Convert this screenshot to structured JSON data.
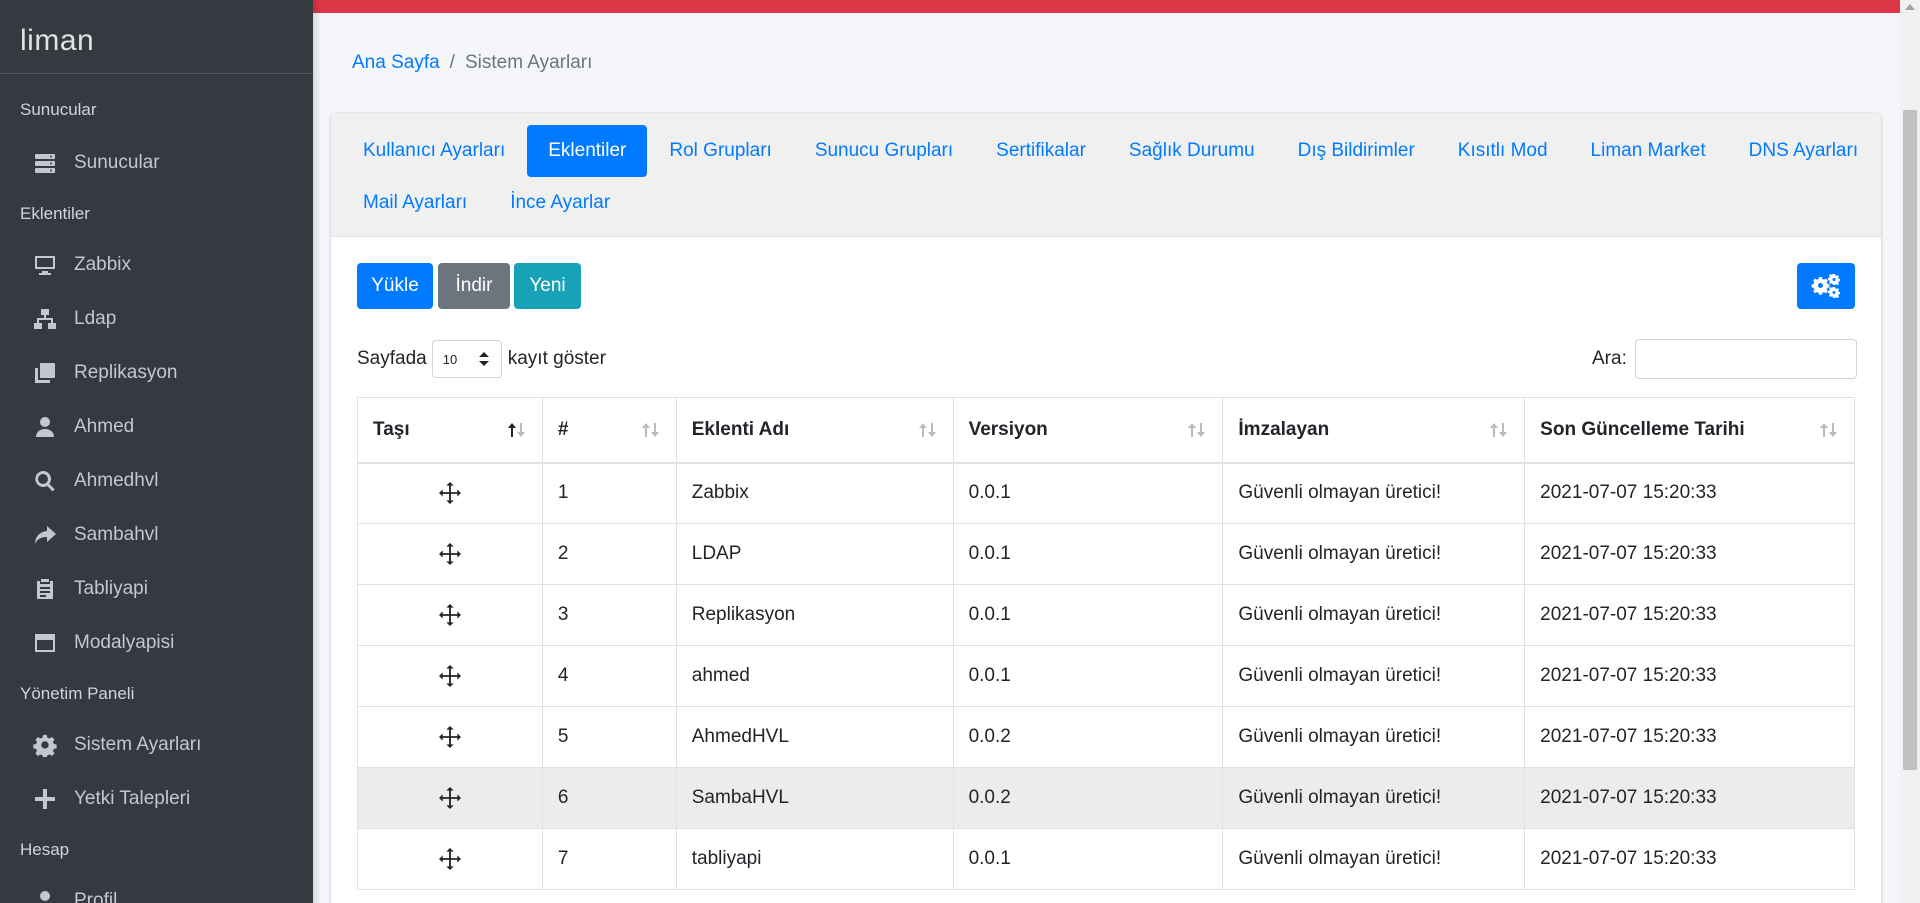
{
  "brand": "liman",
  "sidebar": {
    "sections": [
      {
        "header": "Sunucular",
        "items": [
          {
            "label": "Sunucular",
            "icon": "server-icon"
          }
        ]
      },
      {
        "header": "Eklentiler",
        "items": [
          {
            "label": "Zabbix",
            "icon": "desktop-icon"
          },
          {
            "label": "Ldap",
            "icon": "sitemap-icon"
          },
          {
            "label": "Replikasyon",
            "icon": "copy-icon"
          },
          {
            "label": "Ahmed",
            "icon": "user-icon"
          },
          {
            "label": "Ahmedhvl",
            "icon": "search-icon"
          },
          {
            "label": "Sambahvl",
            "icon": "share-icon"
          },
          {
            "label": "Tabliyapi",
            "icon": "clipboard-icon"
          },
          {
            "label": "Modalyapisi",
            "icon": "window-icon"
          }
        ]
      },
      {
        "header": "Yönetim Paneli",
        "items": [
          {
            "label": "Sistem Ayarları",
            "icon": "gear-icon"
          },
          {
            "label": "Yetki Talepleri",
            "icon": "plus-icon"
          }
        ]
      },
      {
        "header": "Hesap",
        "items": [
          {
            "label": "Profil",
            "icon": "user-icon"
          }
        ]
      }
    ]
  },
  "breadcrumb": {
    "home": "Ana Sayfa",
    "separator": "/",
    "current": "Sistem Ayarları"
  },
  "tabs": [
    {
      "label": "Kullanıcı Ayarları",
      "active": false
    },
    {
      "label": "Eklentiler",
      "active": true
    },
    {
      "label": "Rol Grupları",
      "active": false
    },
    {
      "label": "Sunucu Grupları",
      "active": false
    },
    {
      "label": "Sertifikalar",
      "active": false
    },
    {
      "label": "Sağlık Durumu",
      "active": false
    },
    {
      "label": "Dış Bildirimler",
      "active": false
    },
    {
      "label": "Kısıtlı Mod",
      "active": false
    },
    {
      "label": "Liman Market",
      "active": false
    },
    {
      "label": "DNS Ayarları",
      "active": false
    },
    {
      "label": "Mail Ayarları",
      "active": false
    },
    {
      "label": "İnce Ayarlar",
      "active": false
    }
  ],
  "toolbar": {
    "upload": "Yükle",
    "download": "İndir",
    "new": "Yeni",
    "settings_icon": "cogs-icon"
  },
  "length": {
    "prefix": "Sayfada",
    "value": "10",
    "suffix": "kayıt göster"
  },
  "search": {
    "label": "Ara:",
    "value": ""
  },
  "table": {
    "columns": [
      "Taşı",
      "#",
      "Eklenti Adı",
      "Versiyon",
      "İmzalayan",
      "Son Güncelleme Tarihi"
    ],
    "rows": [
      {
        "num": "1",
        "name": "Zabbix",
        "version": "0.0.1",
        "signer": "Güvenli olmayan üretici!",
        "updated": "2021-07-07 15:20:33"
      },
      {
        "num": "2",
        "name": "LDAP",
        "version": "0.0.1",
        "signer": "Güvenli olmayan üretici!",
        "updated": "2021-07-07 15:20:33"
      },
      {
        "num": "3",
        "name": "Replikasyon",
        "version": "0.0.1",
        "signer": "Güvenli olmayan üretici!",
        "updated": "2021-07-07 15:20:33"
      },
      {
        "num": "4",
        "name": "ahmed",
        "version": "0.0.1",
        "signer": "Güvenli olmayan üretici!",
        "updated": "2021-07-07 15:20:33"
      },
      {
        "num": "5",
        "name": "AhmedHVL",
        "version": "0.0.2",
        "signer": "Güvenli olmayan üretici!",
        "updated": "2021-07-07 15:20:33"
      },
      {
        "num": "6",
        "name": "SambaHVL",
        "version": "0.0.2",
        "signer": "Güvenli olmayan üretici!",
        "updated": "2021-07-07 15:20:33"
      },
      {
        "num": "7",
        "name": "tabliyapi",
        "version": "0.0.1",
        "signer": "Güvenli olmayan üretici!",
        "updated": "2021-07-07 15:20:33"
      }
    ]
  },
  "colors": {
    "sidebar": "#343a40",
    "accent": "#007bff",
    "topbar": "#dc3545",
    "secondary": "#6c757d",
    "info": "#17a2b8"
  }
}
